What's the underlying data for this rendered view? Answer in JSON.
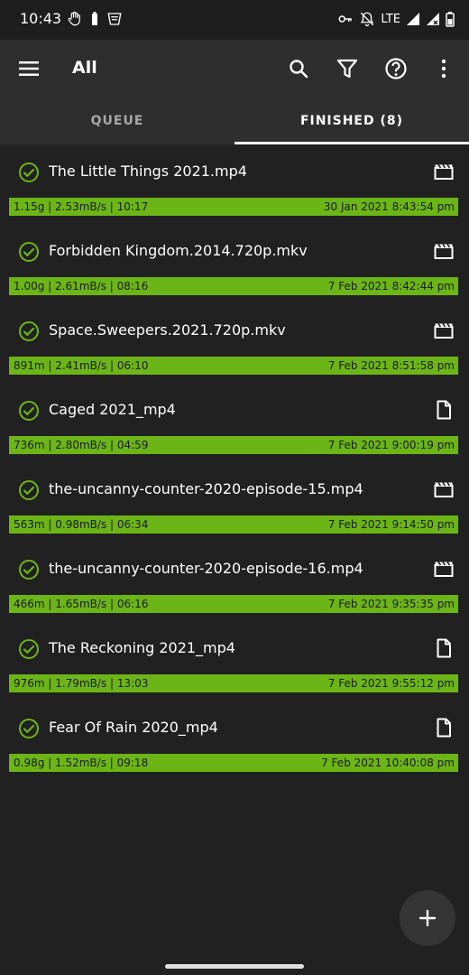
{
  "status": {
    "time": "10:43",
    "network": "LTE"
  },
  "app_bar": {
    "title": "All"
  },
  "tabs": {
    "queue": "QUEUE",
    "finished": "FINISHED (8)"
  },
  "downloads": [
    {
      "name": "The Little Things 2021.mp4",
      "stats": "1.15g | 2.53mB/s | 10:17",
      "date": "30 Jan 2021 8:43:54 pm",
      "type": "video-icon"
    },
    {
      "name": "Forbidden Kingdom.2014.720p.mkv",
      "stats": "1.00g | 2.61mB/s | 08:16",
      "date": "7 Feb 2021 8:42:44 pm",
      "type": "video-icon"
    },
    {
      "name": "Space.Sweepers.2021.720p.mkv",
      "stats": "891m | 2.41mB/s | 06:10",
      "date": "7 Feb 2021 8:51:58 pm",
      "type": "video-icon"
    },
    {
      "name": "Caged 2021_mp4",
      "stats": "736m | 2.80mB/s | 04:59",
      "date": "7 Feb 2021 9:00:19 pm",
      "type": "file-icon"
    },
    {
      "name": "the-uncanny-counter-2020-episode-15.mp4",
      "stats": "563m | 0.98mB/s | 06:34",
      "date": "7 Feb 2021 9:14:50 pm",
      "type": "video-icon"
    },
    {
      "name": "the-uncanny-counter-2020-episode-16.mp4",
      "stats": "466m | 1.65mB/s | 06:16",
      "date": "7 Feb 2021 9:35:35 pm",
      "type": "video-icon"
    },
    {
      "name": "The Reckoning 2021_mp4",
      "stats": "976m | 1.79mB/s | 13:03",
      "date": "7 Feb 2021 9:55:12 pm",
      "type": "file-icon"
    },
    {
      "name": "Fear Of Rain 2020_mp4",
      "stats": "0.98g | 1.52mB/s | 09:18",
      "date": "7 Feb 2021 10:40:08 pm",
      "type": "file-icon"
    }
  ],
  "colors": {
    "accent": "#6cb517",
    "background": "#212121",
    "app_bar": "#2e2e2e"
  }
}
